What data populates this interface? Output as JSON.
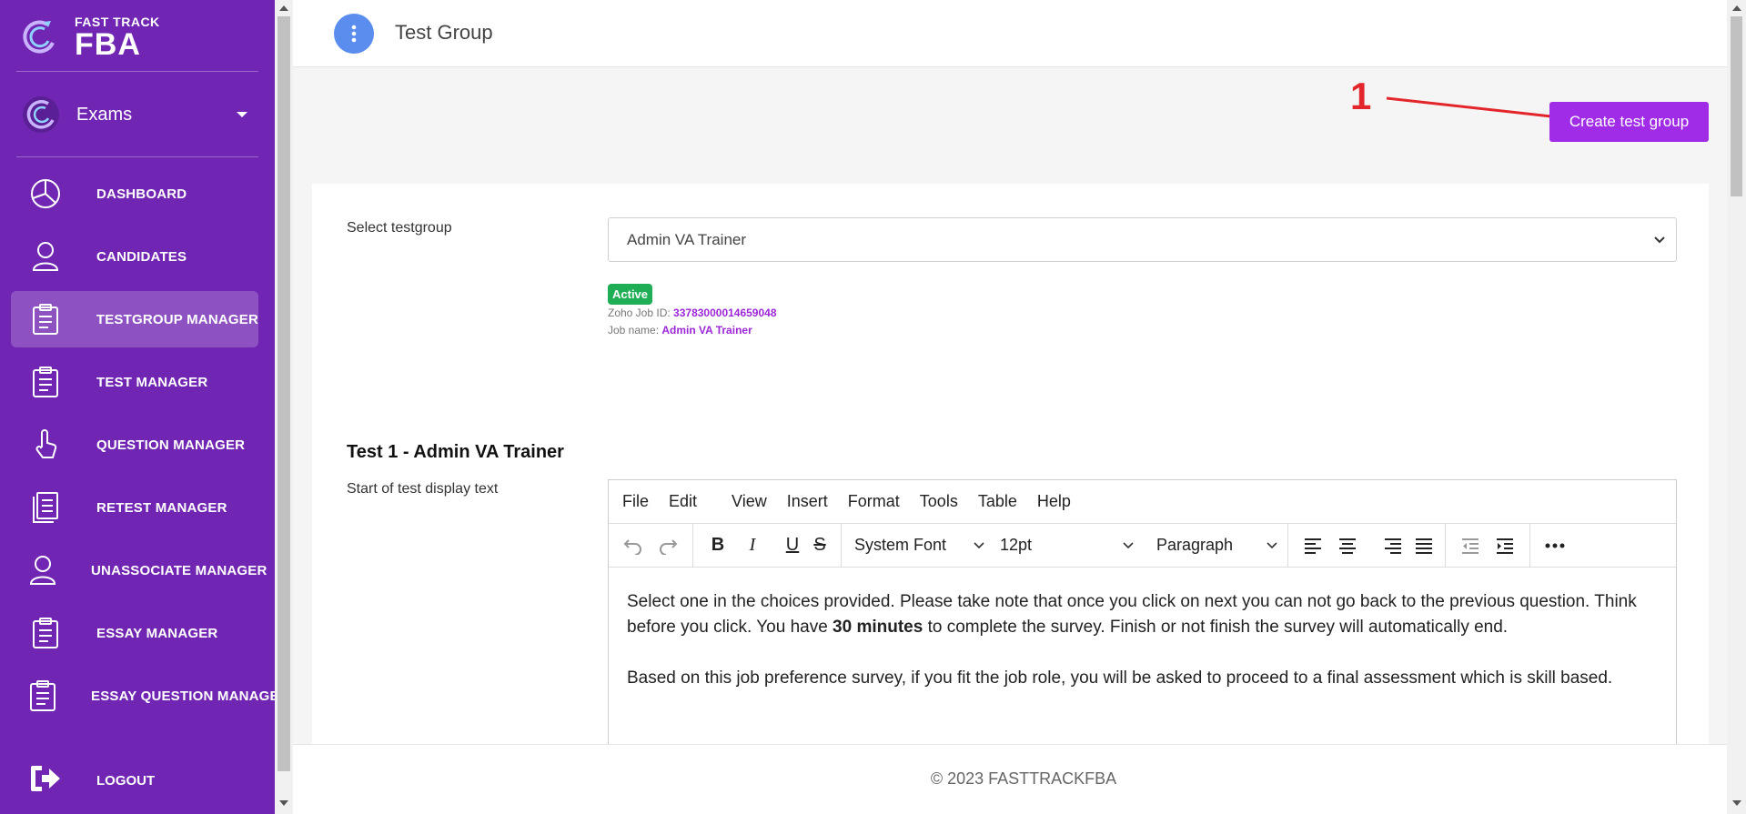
{
  "brand": {
    "line1": "FAST TRACK",
    "line2": "FBA"
  },
  "app_switcher": {
    "label": "Exams"
  },
  "nav": {
    "items": [
      {
        "label": "DASHBOARD",
        "icon": "pie-chart-icon"
      },
      {
        "label": "CANDIDATES",
        "icon": "user-icon"
      },
      {
        "label": "TESTGROUP MANAGER",
        "icon": "clipboard-icon",
        "active": true
      },
      {
        "label": "TEST MANAGER",
        "icon": "clipboard-icon"
      },
      {
        "label": "QUESTION MANAGER",
        "icon": "pointer-hand-icon"
      },
      {
        "label": "RETEST MANAGER",
        "icon": "document-icon"
      },
      {
        "label": "UNASSOCIATE MANAGER",
        "icon": "user-icon"
      },
      {
        "label": "ESSAY MANAGER",
        "icon": "clipboard-icon"
      },
      {
        "label": "ESSAY QUESTION MANAGER",
        "icon": "clipboard-icon"
      }
    ],
    "logout": "LOGOUT"
  },
  "header": {
    "title": "Test Group"
  },
  "annotation": {
    "number": "1"
  },
  "create_button": {
    "label": "Create test group"
  },
  "form": {
    "select_label": "Select testgroup",
    "select_value": "Admin VA Trainer",
    "status_badge": "Active",
    "zoho_label": "Zoho Job ID:",
    "zoho_value": "33783000014659048",
    "job_label": "Job name:",
    "job_value": "Admin VA Trainer"
  },
  "test": {
    "title": "Test 1 - Admin VA Trainer",
    "start_label": "Start of test display text"
  },
  "editor": {
    "menu": [
      "File",
      "Edit",
      "View",
      "Insert",
      "Format",
      "Tools",
      "Table",
      "Help"
    ],
    "font_family": "System Font",
    "font_size": "12pt",
    "block_format": "Paragraph",
    "content": {
      "p1_a": "Select one in the choices provided. Please take note that once you click on next you can not go back to the previous question. Think before you click. You have ",
      "p1_bold": "30 minutes",
      "p1_b": " to complete the survey. Finish or not finish the survey will automatically end.",
      "p2": "Based on this job preference survey, if you fit the job role, you will be asked to proceed to a final assessment which is skill based."
    }
  },
  "footer": {
    "text": "© 2023 FASTTRACKFBA"
  },
  "colors": {
    "sidebar": "#7126b3",
    "accent": "#a12ce8",
    "active_badge": "#1fae55",
    "annotation": "#e3262b"
  }
}
